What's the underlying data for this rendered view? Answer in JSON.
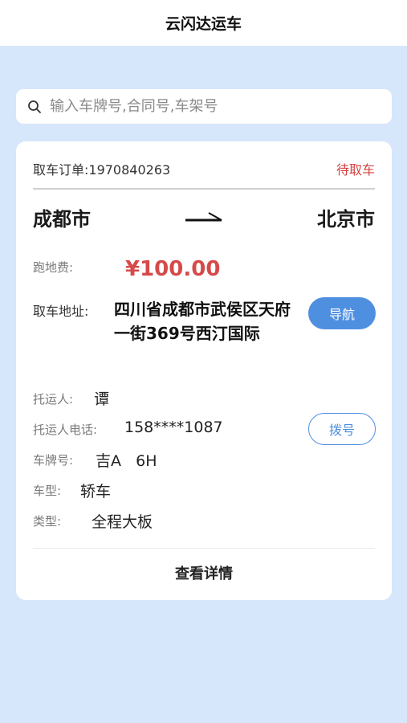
{
  "app": {
    "title": "云闪达运车"
  },
  "search": {
    "placeholder": "输入车牌号,合同号,车架号",
    "value": ""
  },
  "order": {
    "label": "取车订单:1970840263",
    "status": "待取车",
    "from_city": "成都市",
    "to_city": "北京市",
    "fee_label": "跑地费:",
    "fee_value": "¥100.00",
    "address_label": "取车地址:",
    "address_value": "四川省成都市武侯区天府一街369号西汀国际",
    "nav_button": "导航",
    "shipper_label": "托运人:",
    "shipper_value": "谭",
    "phone_label": "托运人电话:",
    "phone_value": "158****1087",
    "dial_button": "拨号",
    "plate_label": "车牌号:",
    "plate_value": "吉A   6H",
    "car_type_label": "车型:",
    "car_type_value": "轿车",
    "kind_label": "类型:",
    "kind_value": "全程大板",
    "detail_button": "查看详情"
  },
  "colors": {
    "background": "#d6e6fb",
    "accent": "#4f8fe0",
    "status_red": "#d74040",
    "price_red": "#d64a4a"
  },
  "icons": {
    "search": "search-icon",
    "route": "arrow-right-icon"
  }
}
